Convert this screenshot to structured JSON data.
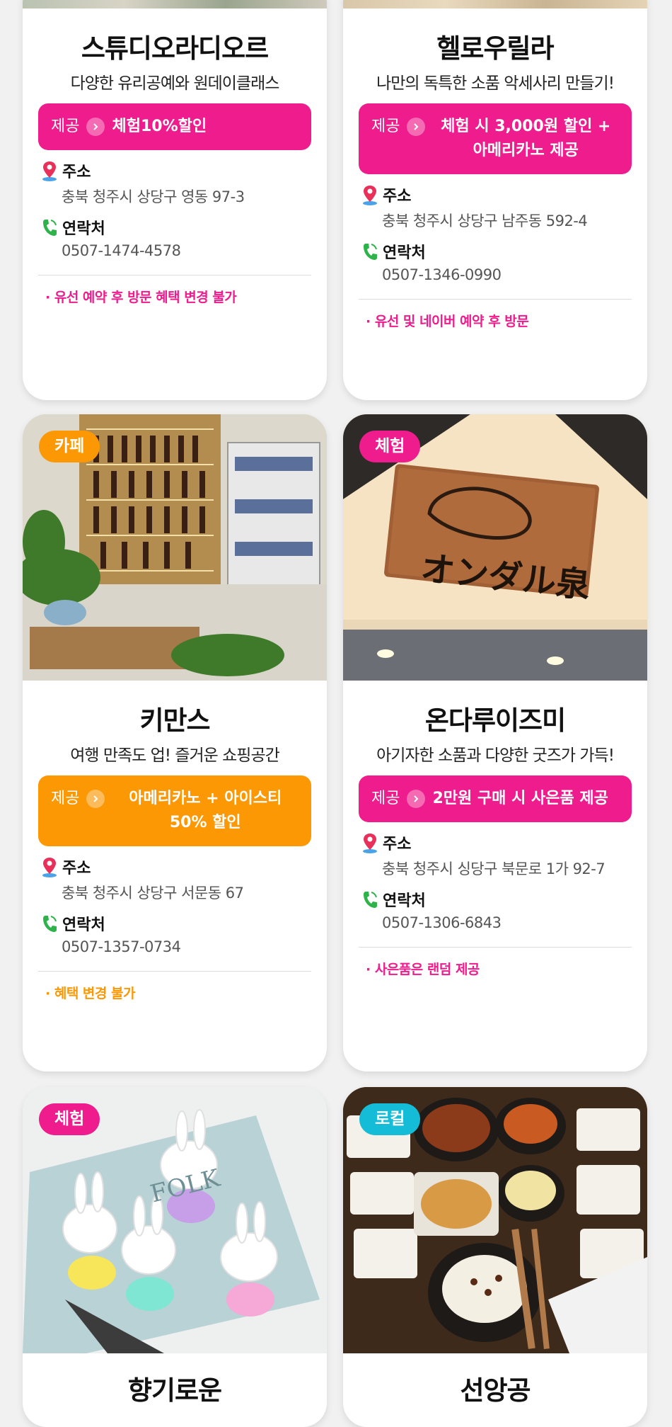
{
  "colors": {
    "pink": "#ee1c8c",
    "orange": "#fb9804",
    "teal": "#14bcd8",
    "pin": "#e8305a",
    "phone": "#2db34a"
  },
  "labels": {
    "offer_tag": "제공",
    "address": "주소",
    "contact": "연락처"
  },
  "cards": [
    {
      "name": "스튜디오라디오르",
      "slogan": "다양한 유리공예와 원데이클래스",
      "offer": "체험10%할인",
      "address": "충북 청주시 상당구 영동 97-3",
      "phone": "0507-1474-4578",
      "note": "· 유선 예약 후 방문 혜택 변경 불가"
    },
    {
      "name": "헬로우릴라",
      "slogan": "나만의 독특한 소품 악세사리 만들기!",
      "offer": "체험 시 3,000원 할인 + 아메리카노 제공",
      "address": "충북 청주시 상당구 남주동 592-4",
      "phone": "0507-1346-0990",
      "note": "· 유선 및 네이버 예약 후 방문"
    },
    {
      "badge": "카페",
      "name": "키만스",
      "slogan": "여행 만족도 업! 즐거운 쇼핑공간",
      "offer": "아메리카노 + 아이스티 50% 할인",
      "address": "충북 청주시 상당구 서문동 67",
      "phone": "0507-1357-0734",
      "note": "· 혜택 변경 불가"
    },
    {
      "badge": "체험",
      "sign_text": "オンダル泉",
      "name": "온다루이즈미",
      "slogan": "아기자한 소품과 다양한 굿즈가 가득!",
      "offer": "2만원 구매 시 사은품 제공",
      "address": "충북 청주시 싱당구 북문로 1가 92-7",
      "phone": "0507-1306-6843",
      "note": "· 사은품은 랜덤 제공"
    },
    {
      "badge": "체험",
      "photo_text": "FOLK",
      "name": "향기로운"
    },
    {
      "badge": "로컬",
      "name": "선앙공"
    }
  ]
}
